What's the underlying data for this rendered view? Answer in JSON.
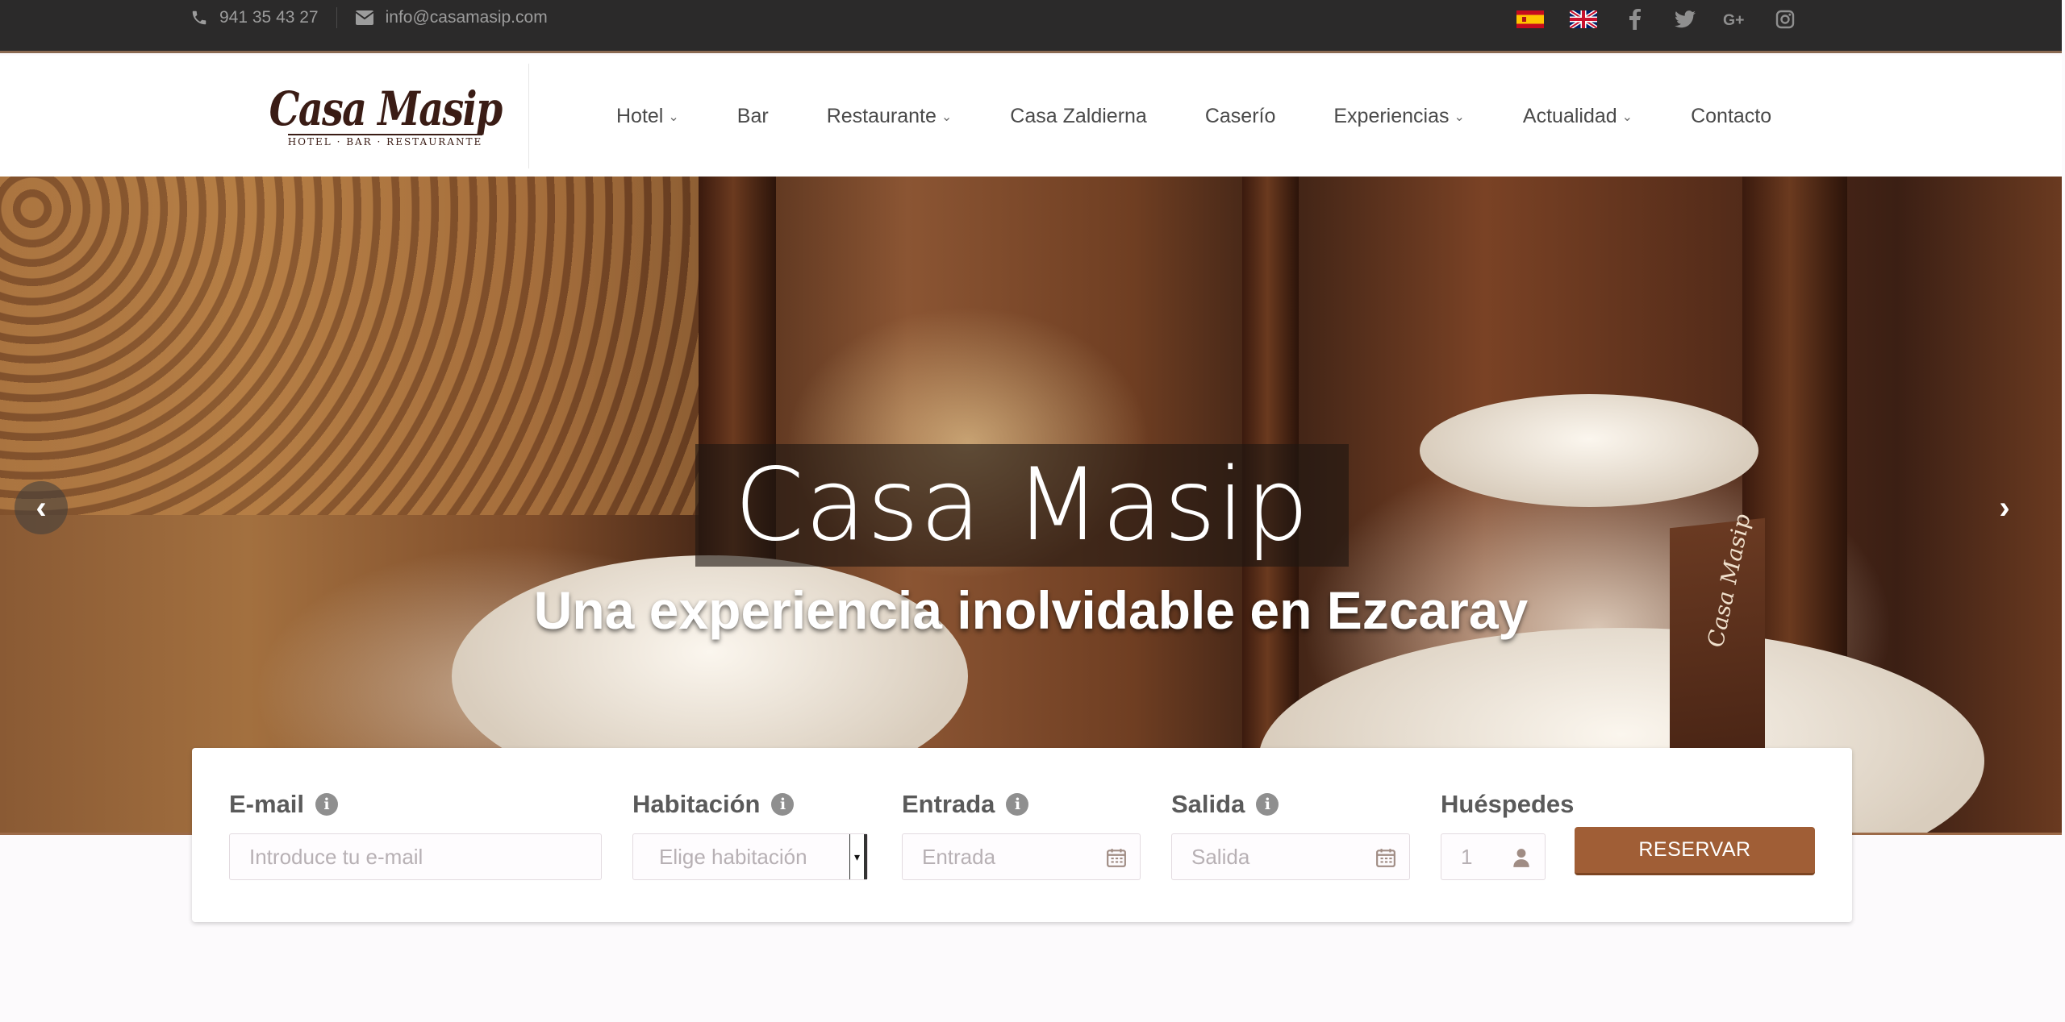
{
  "topbar": {
    "phone": "941 35 43 27",
    "email": "info@casamasip.com",
    "languages": [
      {
        "code": "es",
        "icon": "flag-spain-icon"
      },
      {
        "code": "en",
        "icon": "flag-uk-icon"
      }
    ],
    "social": [
      "facebook-icon",
      "twitter-icon",
      "google-plus-icon",
      "instagram-icon"
    ]
  },
  "logo": {
    "name": "Casa Masip",
    "tagline": "HOTEL · BAR · RESTAURANTE"
  },
  "nav": [
    {
      "label": "Hotel",
      "dropdown": true
    },
    {
      "label": "Bar",
      "dropdown": false
    },
    {
      "label": "Restaurante",
      "dropdown": true
    },
    {
      "label": "Casa Zaldierna",
      "dropdown": false
    },
    {
      "label": "Caserío",
      "dropdown": false
    },
    {
      "label": "Experiencias",
      "dropdown": true
    },
    {
      "label": "Actualidad",
      "dropdown": true
    },
    {
      "label": "Contacto",
      "dropdown": false
    }
  ],
  "hero": {
    "title": "Casa Masip",
    "subtitle": "Una experiencia inolvidable en Ezcaray",
    "menu_card_text": "Casa Masip",
    "prev_icon": "chevron-left-icon",
    "next_icon": "chevron-right-icon"
  },
  "booking": {
    "email": {
      "label": "E-mail",
      "placeholder": "Introduce tu e-mail"
    },
    "room": {
      "label": "Habitación",
      "placeholder": "Elige habitación"
    },
    "checkin": {
      "label": "Entrada",
      "placeholder": "Entrada"
    },
    "checkout": {
      "label": "Salida",
      "placeholder": "Salida"
    },
    "guests": {
      "label": "Huéspedes",
      "value": "1"
    },
    "submit_label": "RESERVAR"
  },
  "colors": {
    "topbar_bg": "#2b2a2a",
    "accent": "#a05e36",
    "nav_text": "#4a4a4a"
  }
}
